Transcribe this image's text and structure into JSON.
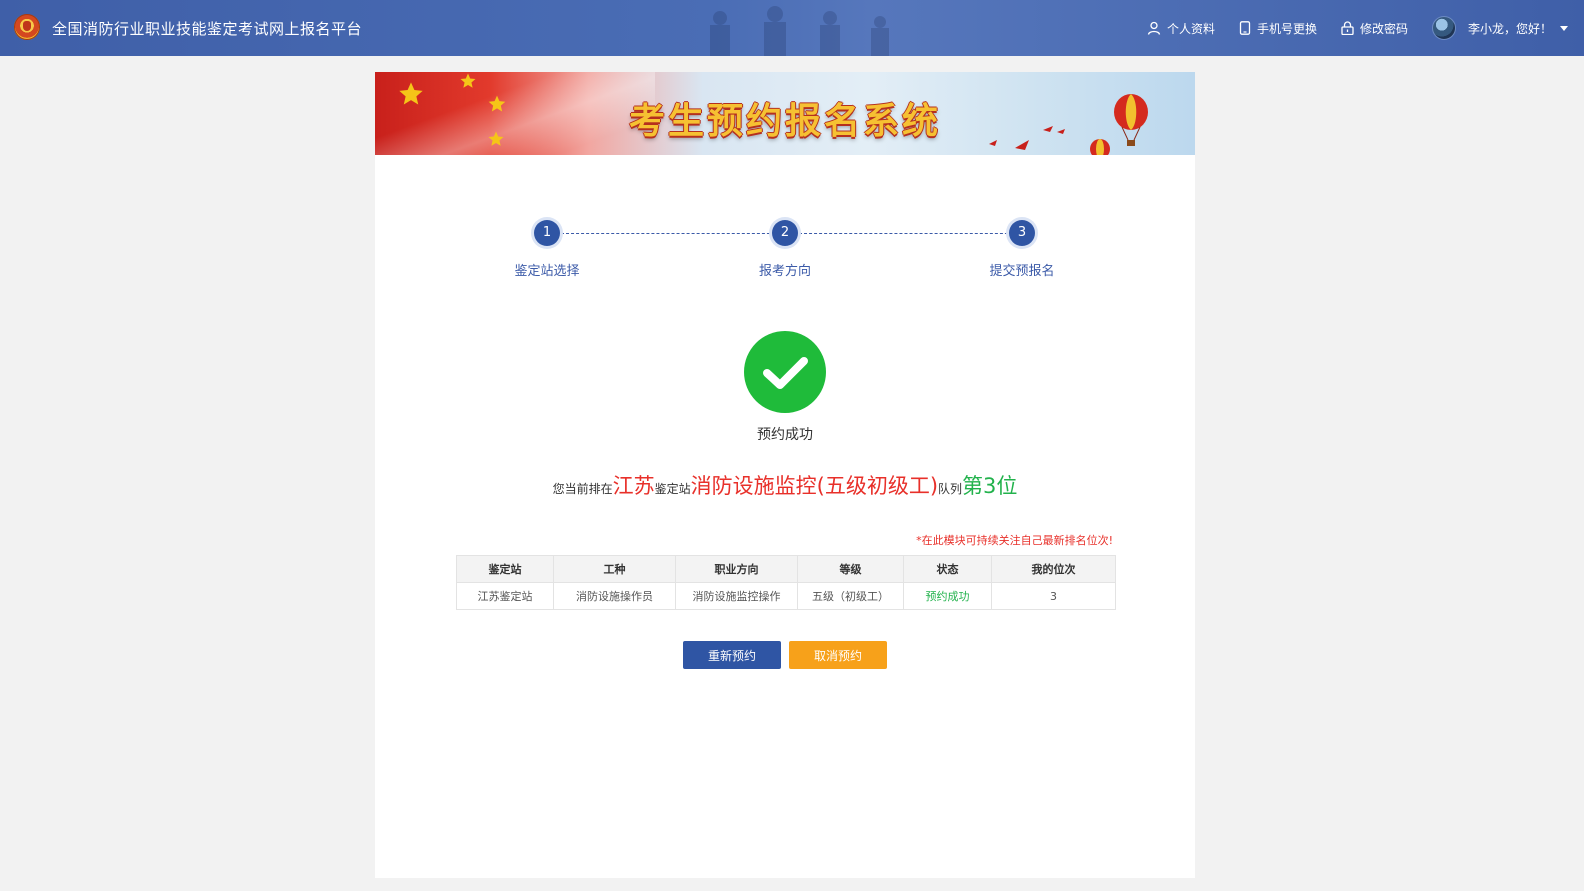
{
  "header": {
    "title": "全国消防行业职业技能鉴定考试网上报名平台",
    "nav": [
      {
        "label": "个人资料",
        "icon": "user-icon"
      },
      {
        "label": "手机号更换",
        "icon": "phone-icon"
      },
      {
        "label": "修改密码",
        "icon": "lock-icon"
      }
    ],
    "user_greeting": "李小龙，您好！"
  },
  "banner": {
    "title": "考生预约报名系统"
  },
  "steps": [
    {
      "number": "1",
      "label": "鉴定站选择"
    },
    {
      "number": "2",
      "label": "报考方向"
    },
    {
      "number": "3",
      "label": "提交预报名"
    }
  ],
  "result": {
    "status_text": "预约成功",
    "queue": {
      "prefix": "您当前排在",
      "province": "江苏",
      "station_word": "鉴定站",
      "direction": "消防设施监控(五级初级工)",
      "queue_word": "队列",
      "position": "第3位"
    },
    "notice": "*在此模块可持续关注自己最新排名位次!"
  },
  "table": {
    "headers": [
      "鉴定站",
      "工种",
      "职业方向",
      "等级",
      "状态",
      "我的位次"
    ],
    "rows": [
      [
        "江苏鉴定站",
        "消防设施操作员",
        "消防设施监控操作",
        "五级（初级工）",
        "预约成功",
        "3"
      ]
    ]
  },
  "buttons": {
    "rebook": "重新预约",
    "cancel": "取消预约"
  },
  "colors": {
    "primary": "#2f55a4",
    "success": "#1fbb3a",
    "highlight_red": "#e8302a",
    "cancel_orange": "#f7a11a"
  }
}
